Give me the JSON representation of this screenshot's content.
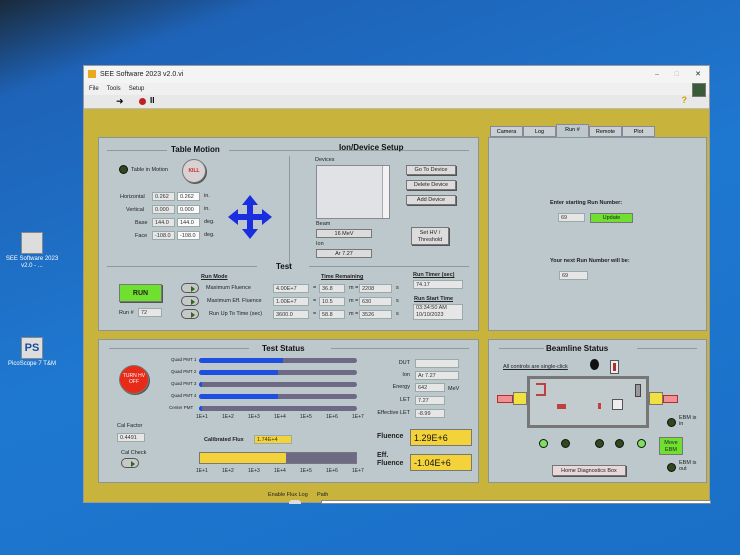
{
  "desktop": {
    "icons": [
      {
        "label": "SEE Software 2023 v2.0 - ...",
        "icon": "labview-vi-icon"
      },
      {
        "label": "PicoScope 7 T&M",
        "icon": "picoscope-icon"
      }
    ]
  },
  "window": {
    "title": "SEE Software 2023 v2.0.vi",
    "menu": [
      "File",
      "Tools",
      "Setup"
    ],
    "controls": [
      "minimize",
      "maximize",
      "close"
    ],
    "help": "?"
  },
  "table_motion": {
    "title": "Table Motion",
    "indicator": "Table in Motion",
    "kill": "KILL",
    "rows": [
      {
        "label": "Horizontal",
        "current": "0.262",
        "target": "0.262",
        "unit": "in."
      },
      {
        "label": "Vertical",
        "current": "0.000",
        "target": "0.000",
        "unit": "in."
      },
      {
        "label": "Base",
        "current": "144.0",
        "target": "144.0",
        "unit": "deg."
      },
      {
        "label": "Face",
        "current": "-108.0",
        "target": "-108.0",
        "unit": "deg."
      }
    ]
  },
  "ion_setup": {
    "title": "Ion/Device Setup",
    "devices_label": "Devices",
    "go": "Go To Device",
    "delete": "Delete Device",
    "add": "Add Device",
    "beam_label": "Beam",
    "beam": "16 MeV",
    "ion_label": "Ion",
    "ion": "Ar 7.27",
    "hv": "Set HV / Threshold"
  },
  "test": {
    "title": "Test",
    "run": "RUN",
    "run_no_label": "Run #",
    "run_no": "72",
    "run_mode": "Run Mode",
    "time_remaining": "Time Remaining",
    "run_timer_label": "Run Timer (sec)",
    "run_timer": "74.17",
    "start_label": "Run Start Time",
    "start_time": "03:34:50 AM",
    "start_date": "10/10/2023",
    "modes": [
      {
        "label": "Maximum Fluence",
        "value": "4.00E+7",
        "min": "36.8",
        "sec": "2208"
      },
      {
        "label": "Maximum Eff. Fluence",
        "value": "1.00E+7",
        "min": "10.5",
        "sec": "630"
      },
      {
        "label": "Run Up To Time (sec)",
        "value": "3600.0",
        "min": "58.8",
        "sec": "3526"
      }
    ],
    "eq": "=",
    "m": "m =",
    "s": "s"
  },
  "tabs": {
    "items": [
      "Camera",
      "Log",
      "Run #",
      "Remote",
      "Plot"
    ],
    "active": "Run #",
    "enter_label": "Enter starting Run Number:",
    "enter_value": "69",
    "update": "Update",
    "next_label": "Your next Run Number will be:",
    "next_value": "69"
  },
  "test_status": {
    "title": "Test Status",
    "hv": "TURN HV OFF",
    "pmts": [
      {
        "label": "Quad PMT 1",
        "fraction": 0.53
      },
      {
        "label": "Quad PMT 2",
        "fraction": 0.5
      },
      {
        "label": "Quad PMT 3",
        "fraction": 0.01
      },
      {
        "label": "Quad PMT 4",
        "fraction": 0.5
      },
      {
        "label": "Center PMT",
        "fraction": 0.01
      }
    ],
    "scale": [
      "1E+1",
      "1E+2",
      "1E+3",
      "1E+4",
      "1E+5",
      "1E+6",
      "1E+7"
    ],
    "cal_factor_label": "Cal Factor",
    "cal_factor": "0.4491",
    "cal_check": "Cal Check",
    "flux_label": "Calibrated Flux",
    "flux": "1.74E+4",
    "flux_fraction": 0.55,
    "dut_label": "DUT",
    "dut": "",
    "ion_label": "Ion",
    "ion": "Ar 7.27",
    "energy_label": "Energy",
    "energy": "642",
    "energy_unit": "MeV",
    "let_label": "LET",
    "let": "7.27",
    "eff_let_label": "Effective LET",
    "eff_let": "-8.99",
    "fluence_label": "Fluence",
    "fluence": "1.29E+6",
    "eff_label": "Eff. Fluence",
    "eff_fluence": "-1.04E+6"
  },
  "beamline": {
    "title": "Beamline Status",
    "note": "All controls are single-click",
    "ebm_in": "EBM is in",
    "ebm_out": "EBM is out",
    "move": "Move EBM",
    "home": "Home Diagnostics Box",
    "leds": [
      true,
      false,
      false,
      false,
      true
    ]
  },
  "footer": {
    "flux_log": "Enable Flux Log",
    "path": "Path"
  },
  "colors": {
    "panel_bg": "#c8b33c",
    "accent_green": "#6fe030",
    "yellow": "#f4d23a",
    "blue_bar": "#1f4fe0"
  }
}
